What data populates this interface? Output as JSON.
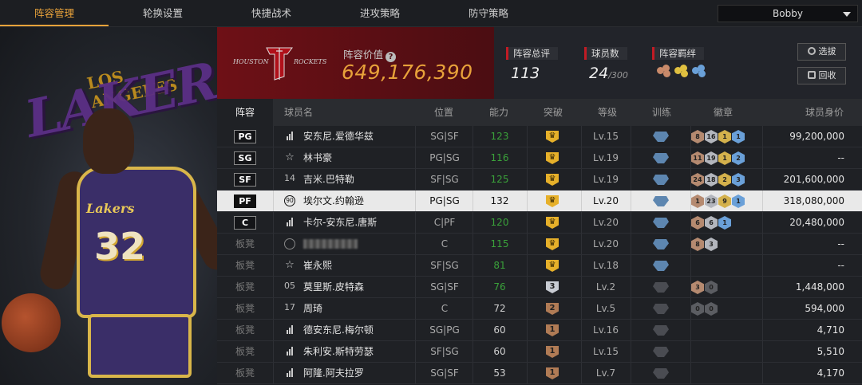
{
  "nav": {
    "tabs": [
      "阵容管理",
      "轮换设置",
      "快捷战术",
      "进攻策略",
      "防守策略"
    ],
    "active_index": 0,
    "user": "Bobby"
  },
  "art": {
    "title_text": "LAKERS",
    "sub_text": "LOS ANGELES",
    "jersey_logo": "Lakers",
    "jersey_number": "32"
  },
  "header": {
    "team_logo_text": "HOUSTON ROCKETS",
    "team_value_label": "阵容价值",
    "team_value": "649,176,390",
    "overall_label": "阵容总评",
    "overall_value": "113",
    "players_label": "球员数",
    "players_value": "24",
    "players_max": "/300",
    "bond_label": "阵容羁绊",
    "bond_colors": [
      "#c98a6a",
      "#e0c040",
      "#6aa0d8"
    ],
    "btn_select": "选拔",
    "btn_recycle": "回收"
  },
  "table": {
    "headers": [
      "阵容",
      "球员名",
      "位置",
      "能力",
      "突破",
      "等级",
      "训练",
      "徽章",
      "球员身价"
    ],
    "rows": [
      {
        "pos": "PG",
        "bench": false,
        "tier": "bars",
        "tier_text": "",
        "name": "安东尼.爱德华兹",
        "position": "SG|SF",
        "ability": "123",
        "ability_color": "green",
        "break": "crown",
        "break_text": "",
        "level": "Lv.15",
        "train": true,
        "badges": [
          [
            "bronze",
            "8"
          ],
          [
            "silver",
            "16"
          ],
          [
            "gold",
            "1"
          ],
          [
            "blue",
            "1"
          ]
        ],
        "value": "99,200,000",
        "selected": false
      },
      {
        "pos": "SG",
        "bench": false,
        "tier": "star",
        "tier_text": "☆",
        "name": "林书豪",
        "position": "PG|SG",
        "ability": "116",
        "ability_color": "green",
        "break": "crown",
        "break_text": "",
        "level": "Lv.19",
        "train": true,
        "badges": [
          [
            "bronze",
            "11"
          ],
          [
            "silver",
            "19"
          ],
          [
            "gold",
            "1"
          ],
          [
            "blue",
            "2"
          ]
        ],
        "value": "--",
        "selected": false
      },
      {
        "pos": "SF",
        "bench": false,
        "tier": "num",
        "tier_text": "14",
        "name": "吉米.巴特勒",
        "position": "SF|SG",
        "ability": "125",
        "ability_color": "green",
        "break": "crown",
        "break_text": "",
        "level": "Lv.19",
        "train": true,
        "badges": [
          [
            "bronze",
            "24"
          ],
          [
            "silver",
            "18"
          ],
          [
            "gold",
            "2"
          ],
          [
            "blue",
            "3"
          ]
        ],
        "value": "201,600,000",
        "selected": false
      },
      {
        "pos": "PF",
        "bench": false,
        "tier": "circle",
        "tier_text": "90",
        "name": "埃尔文.约翰逊",
        "position": "PG|SG",
        "ability": "132",
        "ability_color": "white",
        "break": "crown",
        "break_text": "",
        "level": "Lv.20",
        "train": true,
        "badges": [
          [
            "bronze",
            "1"
          ],
          [
            "silver",
            "23"
          ],
          [
            "gold",
            "9"
          ],
          [
            "blue",
            "1"
          ]
        ],
        "value": "318,080,000",
        "selected": true
      },
      {
        "pos": "C",
        "bench": false,
        "tier": "bars",
        "tier_text": "",
        "name": "卡尔-安东尼.唐斯",
        "position": "C|PF",
        "ability": "120",
        "ability_color": "green",
        "break": "crown",
        "break_text": "",
        "level": "Lv.20",
        "train": true,
        "badges": [
          [
            "bronze",
            "6"
          ],
          [
            "silver",
            "6"
          ],
          [
            "blue",
            "1"
          ]
        ],
        "value": "20,480,000",
        "selected": false
      },
      {
        "pos": "板凳",
        "bench": true,
        "tier": "circle",
        "tier_text": "",
        "name": "",
        "position": "C",
        "ability": "115",
        "ability_color": "green",
        "break": "crown",
        "break_text": "",
        "level": "Lv.20",
        "train": true,
        "badges": [
          [
            "bronze",
            "8"
          ],
          [
            "silver",
            "3"
          ]
        ],
        "value": "--",
        "selected": false,
        "blurred": true
      },
      {
        "pos": "板凳",
        "bench": true,
        "tier": "star",
        "tier_text": "☆",
        "name": "崔永熙",
        "position": "SF|SG",
        "ability": "81",
        "ability_color": "green",
        "break": "crown",
        "break_text": "",
        "level": "Lv.18",
        "train": true,
        "badges": [],
        "value": "--",
        "selected": false
      },
      {
        "pos": "板凳",
        "bench": true,
        "tier": "num",
        "tier_text": "05",
        "name": "莫里斯.皮特森",
        "position": "SG|SF",
        "ability": "76",
        "ability_color": "green",
        "break": "silver",
        "break_text": "3",
        "level": "Lv.2",
        "train": false,
        "badges": [
          [
            "bronze",
            "3"
          ],
          [
            "dark",
            "0"
          ]
        ],
        "value": "1,448,000",
        "selected": false
      },
      {
        "pos": "板凳",
        "bench": true,
        "tier": "num",
        "tier_text": "17",
        "name": "周琦",
        "position": "C",
        "ability": "72",
        "ability_color": "white",
        "break": "bronze",
        "break_text": "2",
        "level": "Lv.5",
        "train": false,
        "badges": [
          [
            "dark",
            "0"
          ],
          [
            "dark",
            "0"
          ]
        ],
        "value": "594,000",
        "selected": false
      },
      {
        "pos": "板凳",
        "bench": true,
        "tier": "bars",
        "tier_text": "",
        "name": "德安东尼.梅尔顿",
        "position": "SG|PG",
        "ability": "60",
        "ability_color": "white",
        "break": "bronze",
        "break_text": "1",
        "level": "Lv.16",
        "train": false,
        "badges": [],
        "value": "4,710",
        "selected": false
      },
      {
        "pos": "板凳",
        "bench": true,
        "tier": "bars",
        "tier_text": "",
        "name": "朱利安.斯特劳瑟",
        "position": "SF|SG",
        "ability": "60",
        "ability_color": "white",
        "break": "bronze",
        "break_text": "1",
        "level": "Lv.15",
        "train": false,
        "badges": [],
        "value": "5,510",
        "selected": false
      },
      {
        "pos": "板凳",
        "bench": true,
        "tier": "bars",
        "tier_text": "",
        "name": "阿隆.阿夫拉罗",
        "position": "SG|SF",
        "ability": "53",
        "ability_color": "white",
        "break": "bronze",
        "break_text": "1",
        "level": "Lv.7",
        "train": false,
        "badges": [],
        "value": "4,170",
        "selected": false
      }
    ]
  },
  "colors": {
    "accent": "#e8a23a",
    "team_red": "#6e1016",
    "green_ability": "#3aa13a"
  }
}
